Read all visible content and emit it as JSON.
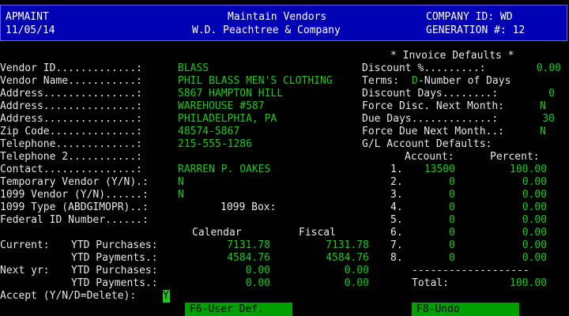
{
  "header": {
    "app_id": "APMAINT",
    "date": "11/05/14",
    "title": "Maintain Vendors",
    "company_name": "W.D. Peachtree & Company",
    "company_id_label": "COMPANY ID: WD",
    "generation_label": "GENERATION #: 12"
  },
  "vendor": {
    "id_label": "Vendor ID.............:",
    "id": "BLASS",
    "name_label": "Vendor Name...........:",
    "name": "PHIL BLASS MEN'S CLOTHING",
    "addr1_label": "Address...............:",
    "addr1": "5867 HAMPTON HILL",
    "addr2_label": "Address...............:",
    "addr2": "WAREHOUSE #587",
    "addr3_label": "Address...............:",
    "addr3": "PHILADELPHIA, PA",
    "zip_label": "Zip Code..............:",
    "zip": "48574-5867",
    "phone_label": "Telephone.............:",
    "phone": "215-555-1286",
    "phone2_label": "Telephone 2...........:",
    "phone2": "",
    "contact_label": "Contact...............:",
    "contact": "RARREN P. OAKES",
    "temp_label": "Temporary Vendor (Y/N).:",
    "temp": "N",
    "v1099_label": "1099 Vendor (Y/N)......:",
    "v1099": "N",
    "type1099_label": "1099 Type (ABDGIMOPR)..:",
    "box1099_label": "1099 Box:",
    "fedid_label": "Federal ID Number......:"
  },
  "ytd": {
    "calendar_header": "Calendar",
    "fiscal_header": "Fiscal",
    "current_label": "Current:",
    "next_label": "Next yr:",
    "purchases_label": "YTD Purchases:",
    "payments_label": "YTD Payments.:",
    "cur_purch_cal": "7131.78",
    "cur_purch_fis": "7131.78",
    "cur_pay_cal": "4584.76",
    "cur_pay_fis": "4584.76",
    "next_purch_cal": "0.00",
    "next_purch_fis": "0.00",
    "next_pay_cal": "0.00",
    "next_pay_fis": "0.00"
  },
  "invoice": {
    "title": "* Invoice Defaults *",
    "discount_label": "Discount %.........:",
    "discount": "0.00",
    "terms_label": "Terms:",
    "terms_code": "D",
    "terms_text": "-Number of Days",
    "disc_days_label": "Discount Days........:",
    "disc_days": "0",
    "force_disc_label": "Force Disc. Next Month:",
    "force_disc": "N",
    "due_days_label": "Due Days.............:",
    "due_days": "30",
    "force_due_label": "Force Due Next Month..:",
    "force_due": "N",
    "gl_title": "G/L Account Defaults:",
    "account_header": "Account:",
    "percent_header": "Percent:",
    "rows": [
      {
        "n": "1.",
        "account": "13500",
        "percent": "100.00"
      },
      {
        "n": "2.",
        "account": "0",
        "percent": "0.00"
      },
      {
        "n": "3.",
        "account": "0",
        "percent": "0.00"
      },
      {
        "n": "4.",
        "account": "0",
        "percent": "0.00"
      },
      {
        "n": "5.",
        "account": "0",
        "percent": "0.00"
      },
      {
        "n": "6.",
        "account": "0",
        "percent": "0.00"
      },
      {
        "n": "7.",
        "account": "0",
        "percent": "0.00"
      },
      {
        "n": "8.",
        "account": "0",
        "percent": "0.00"
      }
    ],
    "separator": "-------------------",
    "total_label": "Total:",
    "total": "100.00"
  },
  "accept": {
    "label": "Accept (Y/N/D=Delete):",
    "value": "Y"
  },
  "fkeys": {
    "f6": "F6-User Def.",
    "f8": "F8-Undo"
  },
  "colors": {
    "header_bg": "#0000b4",
    "field_green": "#1ec81e",
    "fkey_bg": "#00a000"
  }
}
